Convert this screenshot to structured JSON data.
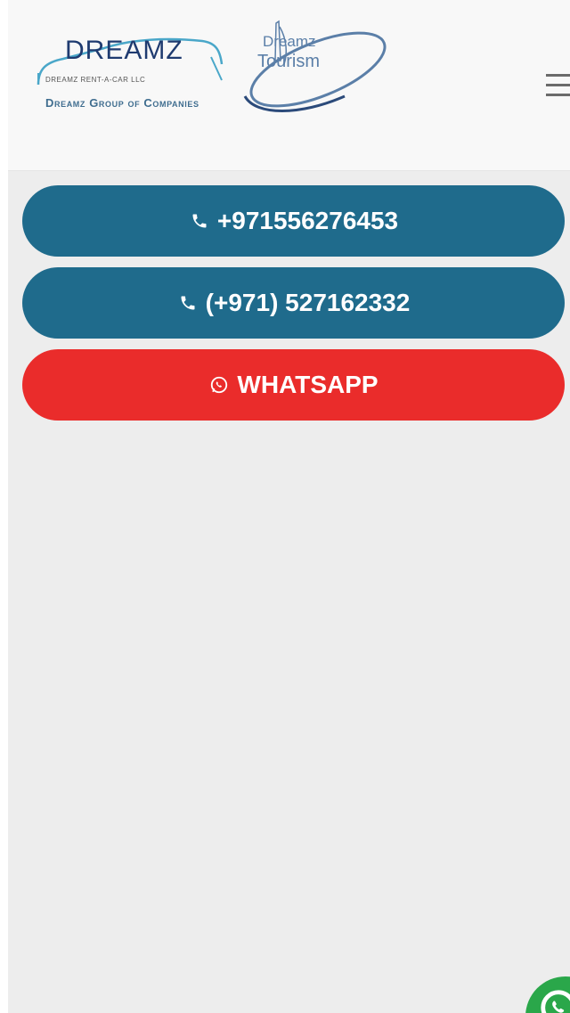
{
  "header": {
    "logo": {
      "brand_main": "DREAMZ",
      "brand_sub": "DREAMZ RENT-A-CAR LLC",
      "group_text": "Dreamz Group of Companies",
      "tourism_top": "Dreamz",
      "tourism_bottom": "Tourism"
    },
    "menu_icon": "hamburger-menu-icon"
  },
  "actions": {
    "phone_1": {
      "label": "+971556276453",
      "icon": "phone-icon"
    },
    "phone_2": {
      "label": "(+971) 527162332",
      "icon": "phone-icon"
    },
    "whatsapp": {
      "label": "WHATSAPP",
      "icon": "whatsapp-icon"
    }
  },
  "floating": {
    "icon": "whatsapp-float-icon"
  },
  "colors": {
    "phone_button": "#1f6b8c",
    "whatsapp_button": "#ea2c2b",
    "background": "#ededed",
    "header_bg": "#f8f8f8",
    "float_green": "#2aa74a"
  }
}
